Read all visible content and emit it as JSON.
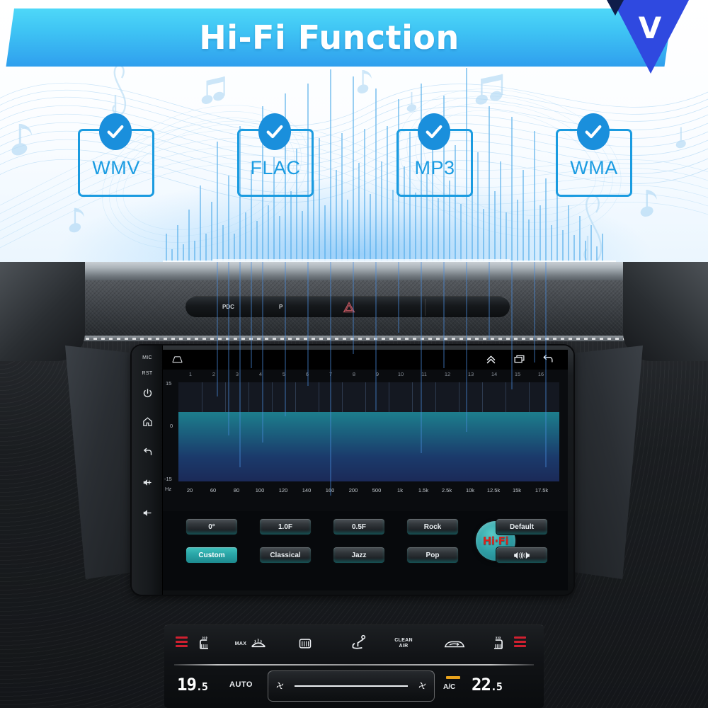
{
  "banner": {
    "title": "Hi-Fi Function",
    "logo_letter": "V",
    "gradient_top": "#4ed8f8",
    "gradient_bottom": "#2f9fee",
    "logo_color": "#2f49e0"
  },
  "formats": {
    "accent_color": "#1a9be0",
    "items": [
      {
        "label": "WMV",
        "check": "check-icon"
      },
      {
        "label": "FLAC",
        "check": "check-icon"
      },
      {
        "label": "MP3",
        "check": "check-icon"
      },
      {
        "label": "WMA",
        "check": "check-icon"
      }
    ]
  },
  "dashboard": {
    "hazard_strip": {
      "buttons": [
        {
          "name": "park-distance-control-button",
          "label": "PDC"
        },
        {
          "name": "auto-hold-button",
          "label": "P"
        },
        {
          "name": "hazard-lights-button",
          "label": "△"
        }
      ]
    }
  },
  "head_unit": {
    "side_buttons": [
      {
        "name": "mic-label",
        "label": "MIC",
        "type": "text"
      },
      {
        "name": "reset-label",
        "label": "RST",
        "type": "text"
      },
      {
        "name": "power-button",
        "label": "",
        "type": "icon",
        "icon": "power-icon"
      },
      {
        "name": "home-button",
        "label": "",
        "type": "icon",
        "icon": "home-icon"
      },
      {
        "name": "back-button",
        "label": "",
        "type": "icon",
        "icon": "back-arrow-icon"
      },
      {
        "name": "volume-up-button",
        "label": "",
        "type": "icon",
        "icon": "volume-up-icon"
      },
      {
        "name": "volume-down-button",
        "label": "",
        "type": "icon",
        "icon": "volume-down-icon"
      }
    ],
    "status_bar": {
      "home_icon": "home-outline-icon",
      "expand_icon": "double-chevron-up-icon",
      "recents_icon": "recents-icon",
      "back_icon": "back-icon"
    },
    "equalizer": {
      "y_top_label": "15",
      "y_mid_label": "0",
      "y_bottom_label": "-15",
      "unit_label": "Hz",
      "band_numbers": [
        "1",
        "2",
        "3",
        "4",
        "5",
        "6",
        "7",
        "8",
        "9",
        "10",
        "11",
        "12",
        "13",
        "14",
        "15",
        "16"
      ],
      "frequencies": [
        "20",
        "60",
        "80",
        "100",
        "120",
        "140",
        "160",
        "200",
        "500",
        "1k",
        "1.5k",
        "2.5k",
        "10k",
        "12.5k",
        "15k",
        "17.5k"
      ],
      "fill_top_color": "#1d7e8d",
      "fill_bottom_color": "#1b2a58"
    },
    "presets": {
      "row1": [
        {
          "name": "phase-0-button",
          "label": "0°",
          "active": false
        },
        {
          "name": "gain-1f-button",
          "label": "1.0F",
          "active": false
        },
        {
          "name": "gain-05f-button",
          "label": "0.5F",
          "active": false
        },
        {
          "name": "rock-preset-button",
          "label": "Rock",
          "active": false
        }
      ],
      "row2": [
        {
          "name": "custom-preset-button",
          "label": "Custom",
          "active": true
        },
        {
          "name": "classical-preset-button",
          "label": "Classical",
          "active": false
        },
        {
          "name": "jazz-preset-button",
          "label": "Jazz",
          "active": false
        },
        {
          "name": "pop-preset-button",
          "label": "Pop",
          "active": false
        }
      ],
      "hifi_knob": {
        "name": "hifi-knob-button",
        "label": "Hi·Fi",
        "color": "#2fa0a6",
        "text_color": "#d8231d"
      },
      "right": [
        {
          "name": "default-button",
          "label": "Default"
        },
        {
          "name": "balance-fader-button",
          "label": "",
          "icon": "speaker-balance-icon"
        }
      ]
    }
  },
  "climate": {
    "top_controls": [
      {
        "name": "driver-seat-heater-button",
        "label": "",
        "icon": "seat-heater-icon",
        "bars": true
      },
      {
        "name": "max-defrost-button",
        "label": "MAX",
        "icon": "windshield-defrost-icon"
      },
      {
        "name": "rear-defrost-button",
        "label": "",
        "icon": "rear-defrost-icon"
      },
      {
        "name": "airflow-mode-button",
        "label": "",
        "icon": "airflow-seat-icon"
      },
      {
        "name": "clean-air-button",
        "label": "CLEAN\nAIR",
        "icon": ""
      },
      {
        "name": "recirculation-button",
        "label": "",
        "icon": "air-recirculation-icon"
      },
      {
        "name": "passenger-seat-heater-button",
        "label": "",
        "icon": "seat-heater-icon",
        "bars": true
      }
    ],
    "clean_air_line1": "CLEAN",
    "clean_air_line2": "AIR",
    "left_temp_whole": "19",
    "left_temp_frac": ".5",
    "right_temp_whole": "22",
    "right_temp_frac": ".5",
    "auto_label": "AUTO",
    "ac_label": "A/C",
    "ac_led_color": "#e8a21c",
    "fan_icon_left": "fan-icon",
    "fan_icon_right": "fan-icon"
  }
}
